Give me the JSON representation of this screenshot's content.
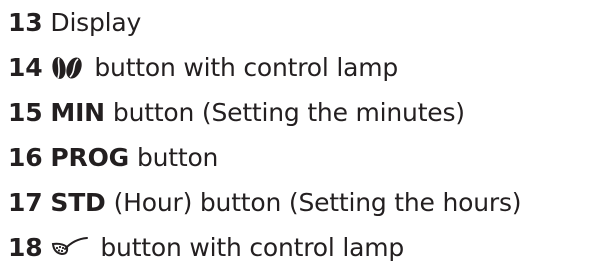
{
  "items": [
    {
      "number": "13",
      "key": "",
      "text": "Display",
      "icon": ""
    },
    {
      "number": "14",
      "key": "",
      "text": "button with control lamp",
      "icon": "coffee-beans-icon"
    },
    {
      "number": "15",
      "key": "MIN",
      "text": "button (Setting the minutes)",
      "icon": ""
    },
    {
      "number": "16",
      "key": "PROG",
      "text": "button",
      "icon": ""
    },
    {
      "number": "17",
      "key": "STD",
      "text": "(Hour) button (Setting the hours)",
      "icon": ""
    },
    {
      "number": "18",
      "key": "",
      "text": "button with control lamp",
      "icon": "grind-spoon-icon"
    }
  ]
}
